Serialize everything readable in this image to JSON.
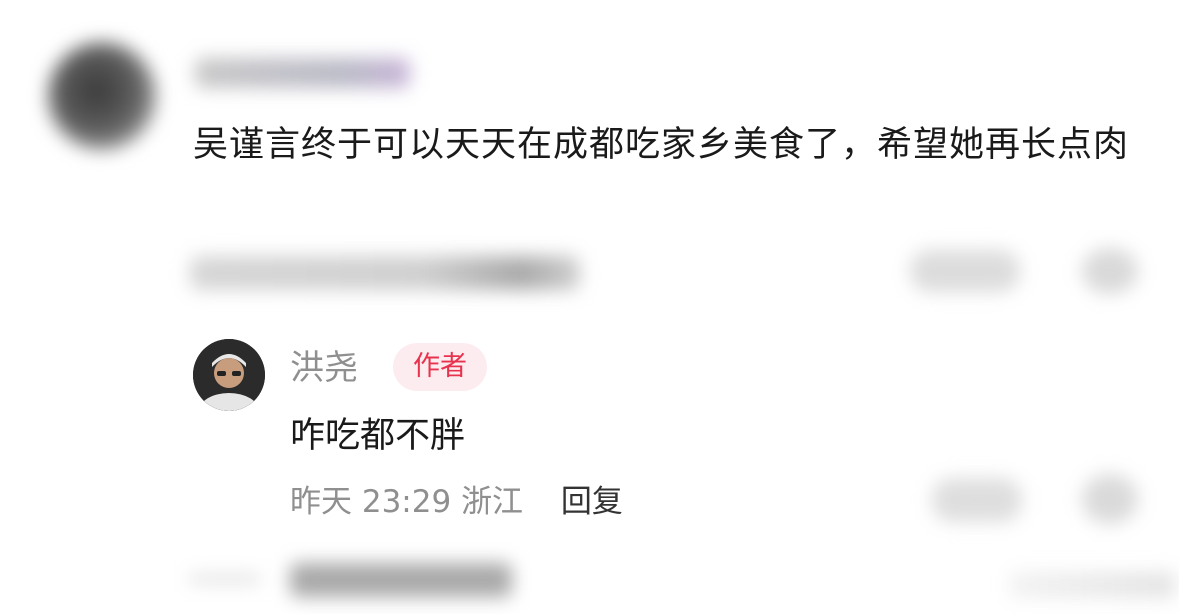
{
  "main_comment": {
    "text": "吴谨言终于可以天天在成都吃家乡美食了，希望她再长点肉"
  },
  "reply": {
    "username": "洪尧",
    "author_badge": "作者",
    "text": "咋吃都不胖",
    "meta": {
      "time": "昨天 23:29",
      "location": "浙江",
      "reply_label": "回复"
    }
  },
  "colors": {
    "badge_bg": "#fdecef",
    "badge_text": "#e8334f",
    "meta_text": "#8f8f8f"
  }
}
